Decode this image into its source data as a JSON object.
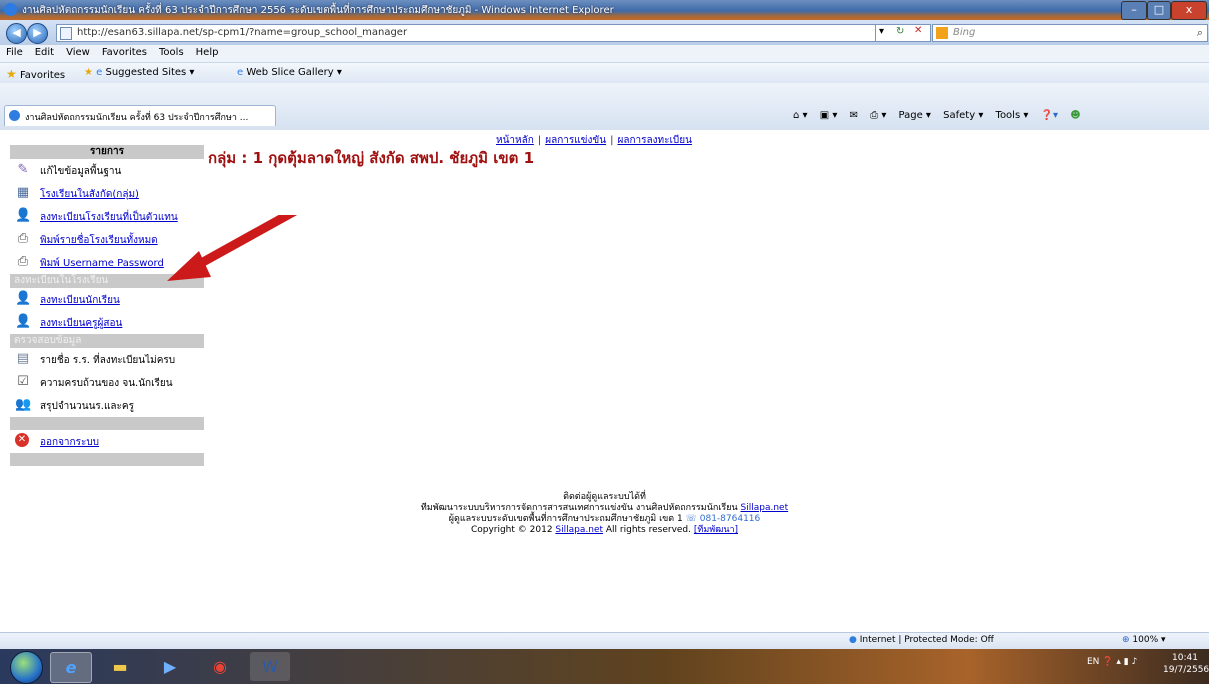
{
  "window": {
    "title": "งานศิลปหัตถกรรมนักเรียน ครั้งที่ 63 ประจำปีการศึกษา 2556 ระดับเขตพื้นที่การศึกษาประถมศึกษาชัยภูมิ - Windows Internet Explorer",
    "minimize": "–",
    "maximize": "□",
    "close": "x"
  },
  "address": {
    "url": "http://esan63.sillapa.net/sp-cpm1/?name=group_school_manager",
    "search_placeholder": "Bing"
  },
  "menu": [
    "File",
    "Edit",
    "View",
    "Favorites",
    "Tools",
    "Help"
  ],
  "favorites_bar": {
    "favorites": "Favorites",
    "suggested": "Suggested Sites ▾",
    "webslice": "Web Slice Gallery ▾"
  },
  "tab": {
    "title": "งานศิลปหัตถกรรมนักเรียน ครั้งที่ 63 ประจำปีการศึกษา ..."
  },
  "commandbar": [
    "Page ▾",
    "Safety ▾",
    "Tools ▾"
  ],
  "top_nav": [
    "หน้าหลัก",
    "ผลการแข่งขัน",
    "ผลการลงทะเบียน"
  ],
  "sidebar": {
    "header": "รายการ",
    "items": [
      {
        "label": "แก้ไขข้อมูลพื้นฐาน",
        "icon": "pencil-icon",
        "link": false
      },
      {
        "label": "โรงเรียนในสังกัด(กลุ่ม)",
        "icon": "grid-icon",
        "link": true
      },
      {
        "label": "ลงทะเบียนโรงเรียนที่เป็นตัวแทน",
        "icon": "person-icon",
        "link": true
      },
      {
        "label": "พิมพ์รายชื่อโรงเรียนทั้งหมด",
        "icon": "printer-icon",
        "link": true
      },
      {
        "label": "พิมพ์ Username Password",
        "icon": "printer-icon",
        "link": true
      }
    ],
    "section2_header": "ลงทะเบียนในโรงเรียน",
    "items2": [
      {
        "label": "ลงทะเบียนนักเรียน",
        "icon": "student-icon",
        "link": true
      },
      {
        "label": "ลงทะเบียนครูผู้สอน",
        "icon": "teacher-icon",
        "link": true
      }
    ],
    "section3_header": "ตรวจสอบข้อมูล",
    "items3": [
      {
        "label": "รายชื่อ ร.ร. ที่ลงทะเบียนไม่ครบ",
        "icon": "document-icon",
        "link": false
      },
      {
        "label": "ความครบถ้วนของ จน.นักเรียน",
        "icon": "checklist-icon",
        "link": false
      },
      {
        "label": "สรุปจำนวนนร.และครู",
        "icon": "people-icon",
        "link": false
      }
    ],
    "logout": {
      "label": "ออกจากระบบ",
      "icon": "close-icon"
    }
  },
  "heading": "กลุ่ม : 1 กุดตุ้มลาดใหญ่ สังกัด สพป. ชัยภูมิ เขต 1",
  "footer": {
    "line1": "ติดต่อผู้ดูแลระบบได้ที่",
    "line2_prefix": "ทีมพัฒนาระบบบริหารการจัดการสารสนเทศการแข่งขัน งานศิลปหัตถกรรมนักเรียน",
    "line2_link": "Sillapa.net",
    "line3": "ผู้ดูแลระบบระดับเขตพื้นที่การศึกษาประถมศึกษาชัยภูมิ เขต 1",
    "phone": "081-8764116",
    "line4_prefix": "Copyright © 2012",
    "line4_link": "Sillapa.net",
    "line4_suffix": "All rights reserved.",
    "line4_team": "[ทีมพัฒนา]"
  },
  "status_bar": {
    "zone": "Internet | Protected Mode: Off",
    "zoom": "100%"
  },
  "tray": {
    "lang": "EN",
    "time": "10:41",
    "date": "19/7/2556"
  },
  "colors": {
    "heading": "#a01010",
    "link": "#0000cc",
    "arrow": "#cc1a1a"
  }
}
